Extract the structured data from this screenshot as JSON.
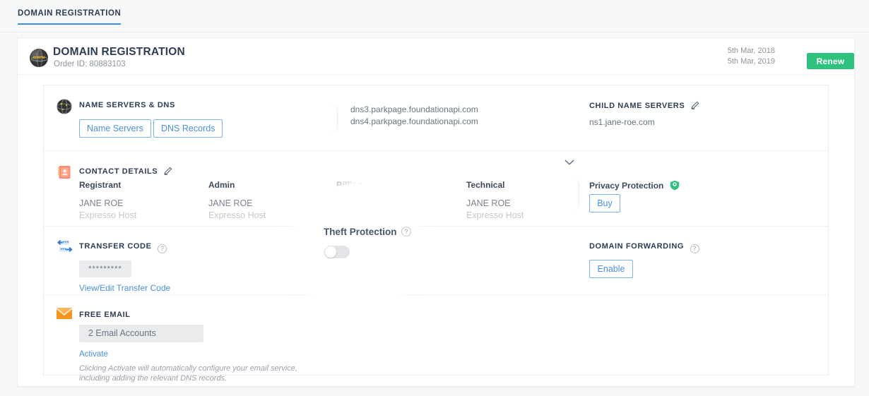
{
  "topbar": {
    "tab_label": "DOMAIN REGISTRATION"
  },
  "order": {
    "title": "DOMAIN REGISTRATION",
    "order_id": "Order ID: 80883103",
    "globe_icon": "www-globe-icon",
    "start_date": "5th Mar, 2018",
    "end_date": "5th Mar, 2019",
    "renew_label": "Renew",
    "renew_color": "#2ec27e"
  },
  "name_servers": {
    "title": "NAME SERVERS & DNS",
    "icon": "globe-network-icon",
    "buttons": [
      {
        "label": "Name Servers"
      },
      {
        "label": "DNS Records"
      }
    ],
    "dns": [
      "dns3.parkpage.foundationapi.com",
      "dns4.parkpage.foundationapi.com"
    ],
    "child": {
      "title": "CHILD NAME SERVERS",
      "edit_icon": "pencil-icon",
      "value": "ns1.jane-roe.com"
    }
  },
  "contact": {
    "title": "CONTACT DETAILS",
    "icon": "address-book-icon",
    "edit_icon": "pencil-icon",
    "collapse_icon": "chevron-down-icon",
    "columns": [
      {
        "heading": "Registrant",
        "name": "JANE ROE",
        "org": "Expresso Host"
      },
      {
        "heading": "Admin",
        "name": "JANE ROE",
        "org": "Expresso Host"
      },
      {
        "heading": "Billing",
        "name": "",
        "org": ""
      },
      {
        "heading": "Technical",
        "name": "JANE ROE",
        "org": "Expresso Host"
      }
    ],
    "privacy": {
      "title": "Privacy Protection",
      "shield_icon": "shield-icon",
      "shield_color": "#2ec27e",
      "button_label": "Buy"
    }
  },
  "transfer": {
    "title": "TRANSFER CODE",
    "icon": "transfer-arrows-icon",
    "help_icon": "question-mark-icon",
    "help_char": "?",
    "masked_value": "*********",
    "link_label": "View/Edit Transfer Code",
    "forwarding": {
      "title": "DOMAIN FORWARDING",
      "help_icon": "question-mark-icon",
      "help_char": "?",
      "button_label": "Enable"
    }
  },
  "free_email": {
    "title": "FREE EMAIL",
    "icon": "envelope-icon",
    "icon_color": "#f7941e",
    "accounts_label": "2 Email Accounts",
    "link_label": "Activate",
    "note": "Clicking Activate will automatically configure your email service, including adding the relevant DNS records."
  },
  "spotlight": {
    "label": "Theft Protection",
    "help_char": "?",
    "help_icon": "question-mark-icon",
    "toggle_icon": "toggle-off-switch",
    "toggle_state": "off"
  }
}
